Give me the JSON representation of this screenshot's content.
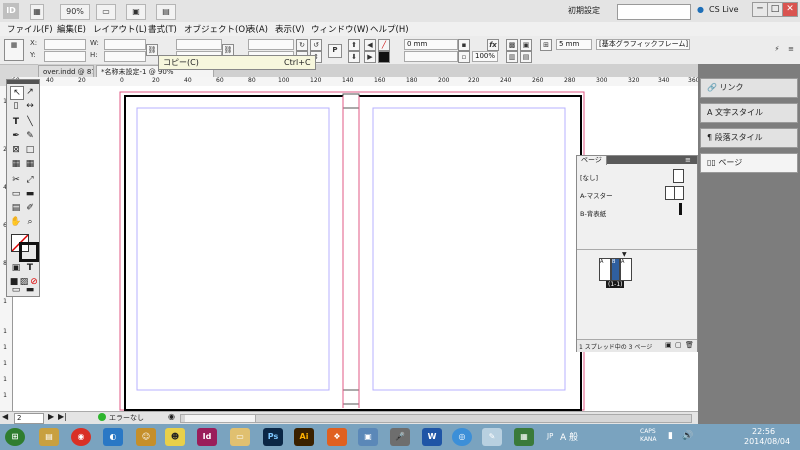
{
  "appbar": {
    "logo": "ID",
    "zoom": "90%",
    "workspace": "初期設定",
    "cslive": "CS Live",
    "minimize": "─",
    "maximize": "□",
    "close": "✕"
  },
  "menu": [
    "ファイル(F)",
    "編集(E)",
    "レイアウト(L)",
    "書式(T)",
    "オブジェクト(O)",
    "表(A)",
    "表示(V)",
    "ウィンドウ(W)",
    "ヘルプ(H)"
  ],
  "control": {
    "x_label": "X:",
    "y_label": "Y:",
    "w_label": "W:",
    "h_label": "H:",
    "stroke_weight": "0 mm",
    "opacity": "100%",
    "offset": "5 mm",
    "frame_style": "[基本グラフィックフレーム]",
    "fx": "fx"
  },
  "tabs": {
    "tab1": "over.indd @ 87%",
    "tab2": "*名称未設定-1 @ 90%",
    "close": "×"
  },
  "tooltip": {
    "label": "コピー(C)",
    "shortcut": "Ctrl+C"
  },
  "ruler": {
    "h": [
      "60",
      "40",
      "20",
      "0",
      "20",
      "40",
      "60",
      "80",
      "100",
      "120",
      "140",
      "160",
      "180",
      "200",
      "220",
      "240",
      "260",
      "280",
      "300",
      "320",
      "340",
      "360"
    ],
    "v": [
      "1",
      "2",
      "4",
      "6",
      "8",
      "1",
      "1",
      "1",
      "1",
      "1",
      "1"
    ]
  },
  "pages_panel": {
    "title": "ページ",
    "none": "[なし]",
    "a_master": "A-マスター",
    "b_master": "B-背表紙",
    "spread_label": "(1-1)",
    "page_a": "A",
    "page_b": "B",
    "footer": "1 スプレッド中の 3 ページ"
  },
  "dock": [
    "リンク",
    "文字スタイル",
    "段落スタイル",
    "ページ"
  ],
  "status": {
    "page": "2",
    "errors": "エラーなし"
  },
  "taskbar": {
    "time": "22:56",
    "date": "2014/08/04",
    "lang": "JP",
    "caps": "CAPS",
    "kana": "KANA",
    "ime": "A 般",
    "icons": [
      "start",
      "explorer",
      "chrome",
      "browser",
      "app-icon",
      "app-icon-2",
      "indesign",
      "folder",
      "photoshop",
      "illustrator",
      "app",
      "app",
      "microphone",
      "word",
      "app",
      "app",
      "app"
    ]
  },
  "colors": {
    "margin": "#c8c8ff",
    "bleed": "#e25a86",
    "panel_bg": "#7d7d7d",
    "accent": "#2f5f9f"
  }
}
